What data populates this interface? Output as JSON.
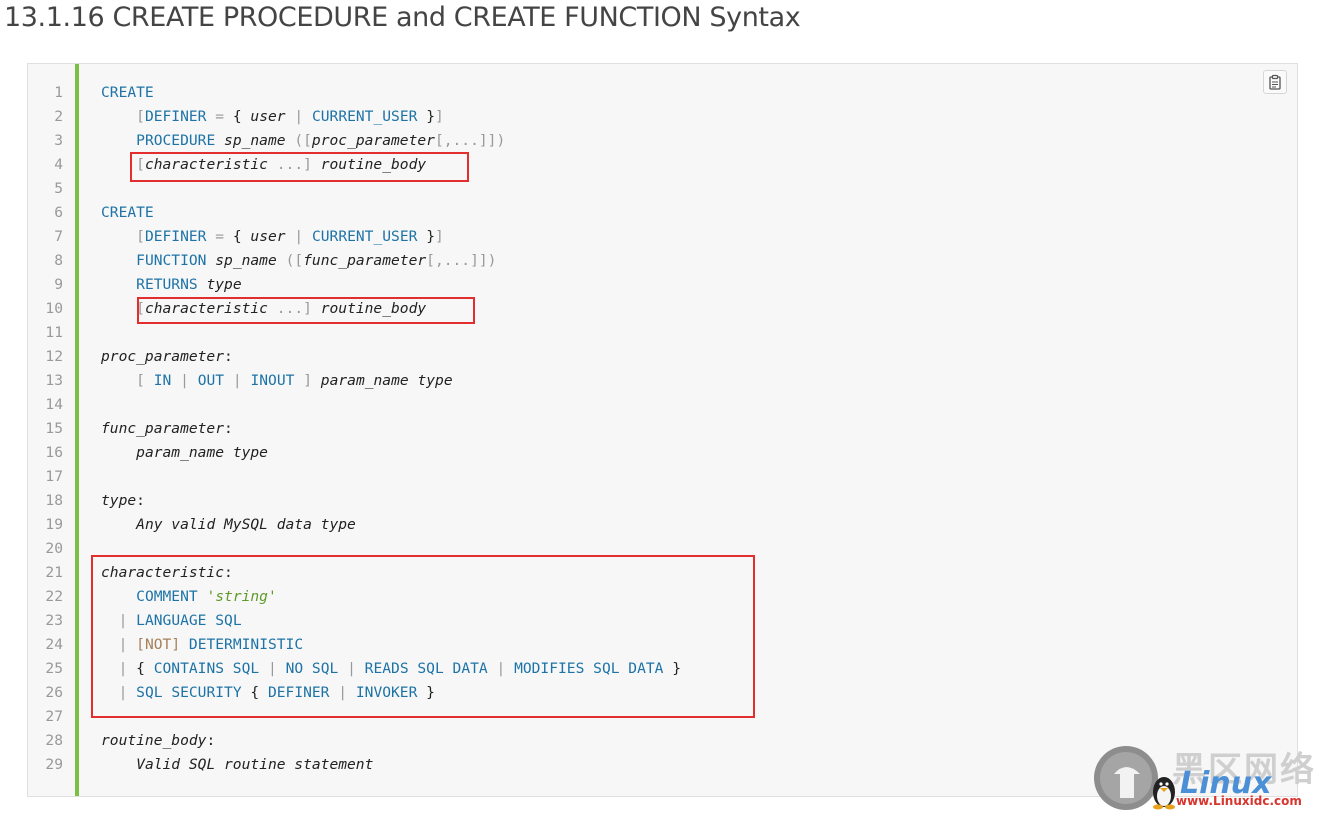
{
  "page": {
    "title": "13.1.16 CREATE PROCEDURE and CREATE FUNCTION Syntax"
  },
  "code_block": {
    "copy_icon": "clipboard-icon",
    "line_numbers": [
      "1",
      "2",
      "3",
      "4",
      "5",
      "6",
      "7",
      "8",
      "9",
      "10",
      "11",
      "12",
      "13",
      "14",
      "15",
      "16",
      "17",
      "18",
      "19",
      "20",
      "21",
      "22",
      "23",
      "24",
      "25",
      "26",
      "27",
      "28",
      "29"
    ],
    "lines": [
      [
        [
          "kw",
          "CREATE"
        ]
      ],
      [
        [
          "t",
          "    "
        ],
        [
          "pn",
          "["
        ],
        [
          "kw",
          "DEFINER"
        ],
        [
          "t",
          " "
        ],
        [
          "pn",
          "="
        ],
        [
          "t",
          " { "
        ],
        [
          "it",
          "user"
        ],
        [
          "t",
          " "
        ],
        [
          "pn",
          "|"
        ],
        [
          "t",
          " "
        ],
        [
          "kw",
          "CURRENT_USER"
        ],
        [
          "t",
          " }"
        ],
        [
          "pn",
          "]"
        ]
      ],
      [
        [
          "t",
          "    "
        ],
        [
          "kw",
          "PROCEDURE"
        ],
        [
          "t",
          " "
        ],
        [
          "it",
          "sp_name"
        ],
        [
          "t",
          " "
        ],
        [
          "pn",
          "(["
        ],
        [
          "it",
          "proc_parameter"
        ],
        [
          "pn",
          "[,...]])"
        ]
      ],
      [
        [
          "t",
          "    "
        ],
        [
          "pn",
          "["
        ],
        [
          "it",
          "characteristic"
        ],
        [
          "t",
          " "
        ],
        [
          "pn",
          "...]"
        ],
        [
          "t",
          " "
        ],
        [
          "it",
          "routine_body"
        ]
      ],
      [],
      [
        [
          "kw",
          "CREATE"
        ]
      ],
      [
        [
          "t",
          "    "
        ],
        [
          "pn",
          "["
        ],
        [
          "kw",
          "DEFINER"
        ],
        [
          "t",
          " "
        ],
        [
          "pn",
          "="
        ],
        [
          "t",
          " { "
        ],
        [
          "it",
          "user"
        ],
        [
          "t",
          " "
        ],
        [
          "pn",
          "|"
        ],
        [
          "t",
          " "
        ],
        [
          "kw",
          "CURRENT_USER"
        ],
        [
          "t",
          " }"
        ],
        [
          "pn",
          "]"
        ]
      ],
      [
        [
          "t",
          "    "
        ],
        [
          "kw",
          "FUNCTION"
        ],
        [
          "t",
          " "
        ],
        [
          "it",
          "sp_name"
        ],
        [
          "t",
          " "
        ],
        [
          "pn",
          "(["
        ],
        [
          "it",
          "func_parameter"
        ],
        [
          "pn",
          "[,...]])"
        ]
      ],
      [
        [
          "t",
          "    "
        ],
        [
          "kw",
          "RETURNS"
        ],
        [
          "t",
          " "
        ],
        [
          "it",
          "type"
        ]
      ],
      [
        [
          "t",
          "    "
        ],
        [
          "pn",
          "["
        ],
        [
          "it",
          "characteristic"
        ],
        [
          "t",
          " "
        ],
        [
          "pn",
          "...]"
        ],
        [
          "t",
          " "
        ],
        [
          "it",
          "routine_body"
        ]
      ],
      [],
      [
        [
          "it",
          "proc_parameter"
        ],
        [
          "t",
          ":"
        ]
      ],
      [
        [
          "t",
          "    "
        ],
        [
          "pn",
          "["
        ],
        [
          "t",
          " "
        ],
        [
          "kw",
          "IN"
        ],
        [
          "t",
          " "
        ],
        [
          "pn",
          "|"
        ],
        [
          "t",
          " "
        ],
        [
          "kw",
          "OUT"
        ],
        [
          "t",
          " "
        ],
        [
          "pn",
          "|"
        ],
        [
          "t",
          " "
        ],
        [
          "kw",
          "INOUT"
        ],
        [
          "t",
          " "
        ],
        [
          "pn",
          "]"
        ],
        [
          "t",
          " "
        ],
        [
          "it",
          "param_name"
        ],
        [
          "t",
          " "
        ],
        [
          "it",
          "type"
        ]
      ],
      [],
      [
        [
          "it",
          "func_parameter"
        ],
        [
          "t",
          ":"
        ]
      ],
      [
        [
          "t",
          "    "
        ],
        [
          "it",
          "param_name"
        ],
        [
          "t",
          " "
        ],
        [
          "it",
          "type"
        ]
      ],
      [],
      [
        [
          "it",
          "type"
        ],
        [
          "t",
          ":"
        ]
      ],
      [
        [
          "t",
          "    "
        ],
        [
          "it",
          "Any valid MySQL data type"
        ]
      ],
      [],
      [
        [
          "it",
          "characteristic"
        ],
        [
          "t",
          ":"
        ]
      ],
      [
        [
          "t",
          "    "
        ],
        [
          "kw",
          "COMMENT"
        ],
        [
          "t",
          " "
        ],
        [
          "str",
          "'string'"
        ]
      ],
      [
        [
          "t",
          "  "
        ],
        [
          "pn",
          "|"
        ],
        [
          "t",
          " "
        ],
        [
          "kw",
          "LANGUAGE SQL"
        ]
      ],
      [
        [
          "t",
          "  "
        ],
        [
          "pn",
          "|"
        ],
        [
          "t",
          " "
        ],
        [
          "nt",
          "[NOT]"
        ],
        [
          "t",
          " "
        ],
        [
          "kw",
          "DETERMINISTIC"
        ]
      ],
      [
        [
          "t",
          "  "
        ],
        [
          "pn",
          "|"
        ],
        [
          "t",
          " { "
        ],
        [
          "kw",
          "CONTAINS SQL"
        ],
        [
          "t",
          " "
        ],
        [
          "pn",
          "|"
        ],
        [
          "t",
          " "
        ],
        [
          "kw",
          "NO SQL"
        ],
        [
          "t",
          " "
        ],
        [
          "pn",
          "|"
        ],
        [
          "t",
          " "
        ],
        [
          "kw",
          "READS SQL DATA"
        ],
        [
          "t",
          " "
        ],
        [
          "pn",
          "|"
        ],
        [
          "t",
          " "
        ],
        [
          "kw",
          "MODIFIES SQL DATA"
        ],
        [
          "t",
          " }"
        ]
      ],
      [
        [
          "t",
          "  "
        ],
        [
          "pn",
          "|"
        ],
        [
          "t",
          " "
        ],
        [
          "kw",
          "SQL SECURITY"
        ],
        [
          "t",
          " { "
        ],
        [
          "kw",
          "DEFINER"
        ],
        [
          "t",
          " "
        ],
        [
          "pn",
          "|"
        ],
        [
          "t",
          " "
        ],
        [
          "kw",
          "INVOKER"
        ],
        [
          "t",
          " }"
        ]
      ],
      [],
      [
        [
          "it",
          "routine_body"
        ],
        [
          "t",
          ":"
        ]
      ],
      [
        [
          "t",
          "    "
        ],
        [
          "it",
          "Valid SQL routine statement"
        ]
      ]
    ],
    "highlight_color": "#e32e2e",
    "gutter_color": "#7ac143"
  },
  "watermark": {
    "chinese": "黑区网络",
    "brand": "Linux",
    "url": "www.Linuxidc.com"
  }
}
